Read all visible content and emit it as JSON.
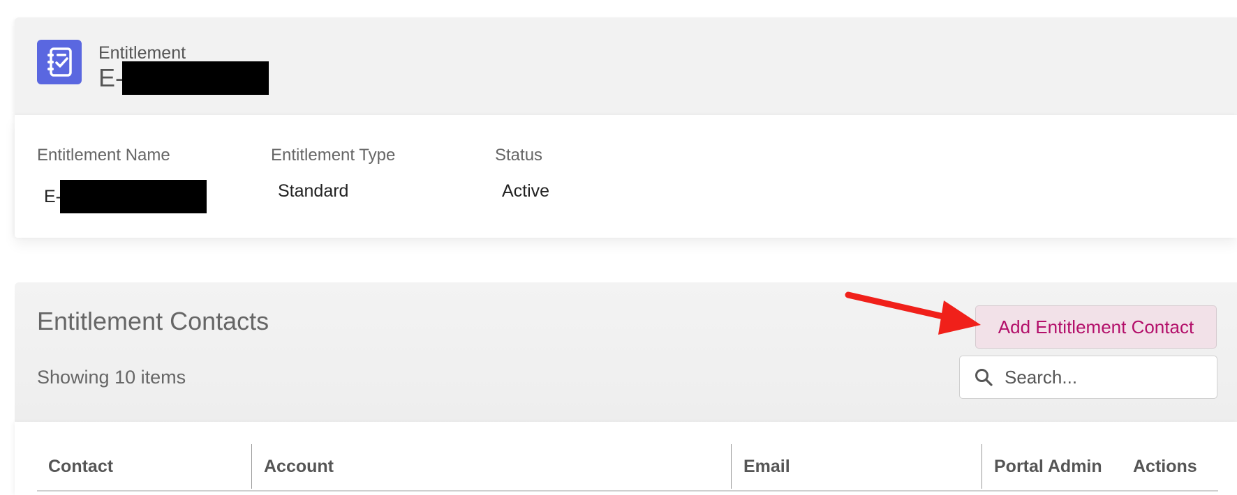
{
  "header": {
    "object_label": "Entitlement",
    "record_title_prefix": "E-",
    "icon": "entitlement-checklist-icon"
  },
  "details": {
    "fields": [
      {
        "label": "Entitlement Name",
        "value": "E-"
      },
      {
        "label": "Entitlement Type",
        "value": "Standard"
      },
      {
        "label": "Status",
        "value": "Active"
      }
    ]
  },
  "contacts": {
    "title": "Entitlement Contacts",
    "items_count_text": "Showing 10 items",
    "add_button_label": "Add Entitlement Contact",
    "search": {
      "placeholder": "Search...",
      "value": "",
      "icon": "search-icon"
    },
    "columns": [
      "Contact",
      "Account",
      "Email",
      "Portal Admin",
      "Actions"
    ]
  },
  "annotation": {
    "arrow_color": "#f0201a"
  },
  "colors": {
    "icon_bg": "#5a67e0",
    "button_bg": "#f2e1e8",
    "button_text": "#b30f6a"
  }
}
